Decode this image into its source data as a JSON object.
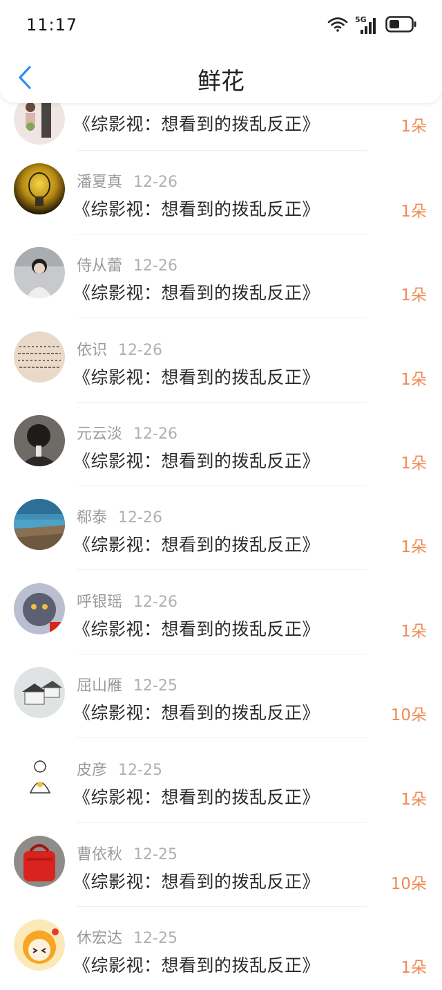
{
  "status_bar": {
    "time": "11:17",
    "network_label": "5G"
  },
  "header": {
    "title": "鲜花"
  },
  "colors": {
    "accent_blue": "#2f8df5",
    "count_orange": "#ef8a52"
  },
  "rows": [
    {
      "name": "",
      "date": "",
      "book": "《综影视：想看到的拨乱反正》",
      "count": "1朵",
      "avatar_icon": "avatar-figure-icon"
    },
    {
      "name": "潘夏真",
      "date": "12-26",
      "book": "《综影视：想看到的拨乱反正》",
      "count": "1朵",
      "avatar_icon": "lightbulb-avatar-icon"
    },
    {
      "name": "侍从蕾",
      "date": "12-26",
      "book": "《综影视：想看到的拨乱反正》",
      "count": "1朵",
      "avatar_icon": "girl-photo-avatar-icon"
    },
    {
      "name": "依识",
      "date": "12-26",
      "book": "《综影视：想看到的拨乱反正》",
      "count": "1朵",
      "avatar_icon": "calligraphy-avatar-icon"
    },
    {
      "name": "元云淡",
      "date": "12-26",
      "book": "《综影视：想看到的拨乱反正》",
      "count": "1朵",
      "avatar_icon": "dark-portrait-avatar-icon"
    },
    {
      "name": "郗泰",
      "date": "12-26",
      "book": "《综影视：想看到的拨乱反正》",
      "count": "1朵",
      "avatar_icon": "seaside-avatar-icon"
    },
    {
      "name": "呼银瑶",
      "date": "12-26",
      "book": "《综影视：想看到的拨乱反正》",
      "count": "1朵",
      "avatar_icon": "cat-avatar-icon"
    },
    {
      "name": "屈山雁",
      "date": "12-25",
      "book": "《综影视：想看到的拨乱反正》",
      "count": "10朵",
      "avatar_icon": "ink-house-avatar-icon"
    },
    {
      "name": "皮彦",
      "date": "12-25",
      "book": "《综影视：想看到的拨乱反正》",
      "count": "1朵",
      "avatar_icon": "sketch-girl-avatar-icon"
    },
    {
      "name": "曹依秋",
      "date": "12-25",
      "book": "《综影视：想看到的拨乱反正》",
      "count": "10朵",
      "avatar_icon": "red-bag-avatar-icon"
    },
    {
      "name": "休宏达",
      "date": "12-25",
      "book": "《综影视：想看到的拨乱反正》",
      "count": "1朵",
      "avatar_icon": "cartoon-girl-avatar-icon"
    }
  ]
}
